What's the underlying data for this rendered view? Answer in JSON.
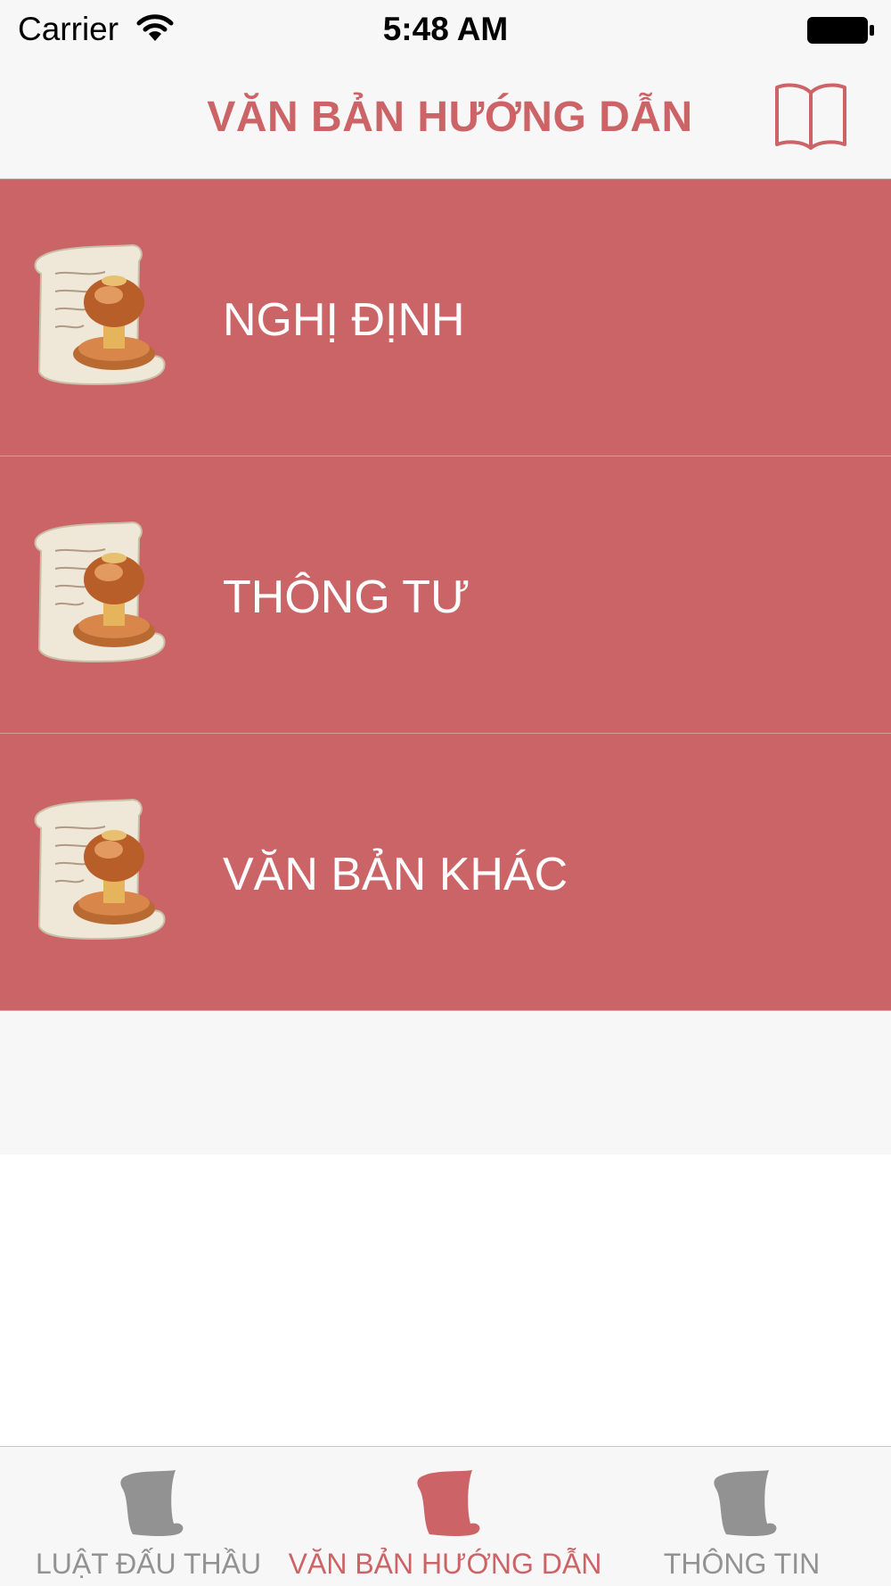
{
  "status_bar": {
    "carrier": "Carrier",
    "time": "5:48 AM"
  },
  "nav": {
    "title": "VĂN BẢN HƯỚNG DẪN",
    "right_icon": "book-icon"
  },
  "list": {
    "items": [
      {
        "label": "NGHỊ ĐỊNH",
        "icon": "scroll-stamp-icon"
      },
      {
        "label": "THÔNG TƯ",
        "icon": "scroll-stamp-icon"
      },
      {
        "label": "VĂN BẢN KHÁC",
        "icon": "scroll-stamp-icon"
      }
    ]
  },
  "tab_bar": {
    "tabs": [
      {
        "label": "LUẬT ĐẤU THẦU",
        "icon": "scroll-icon",
        "active": false
      },
      {
        "label": "VĂN BẢN HƯỚNG DẪN",
        "icon": "scroll-icon",
        "active": true
      },
      {
        "label": "THÔNG TIN",
        "icon": "scroll-icon",
        "active": false
      }
    ]
  },
  "colors": {
    "accent": "#cc6467",
    "row_background": "#cb6467",
    "inactive_tab": "#929292",
    "bar_background": "#f7f7f7"
  }
}
